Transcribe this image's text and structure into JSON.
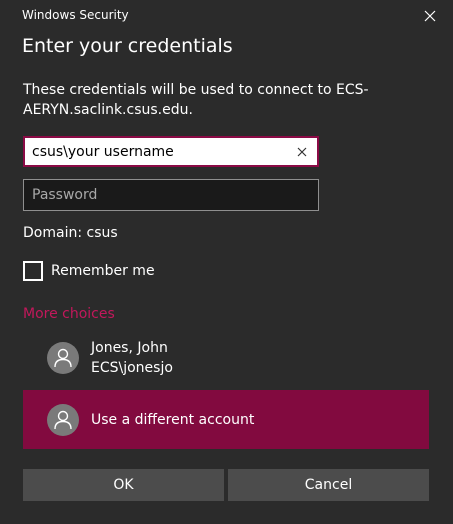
{
  "window": {
    "title": "Windows Security",
    "close_icon": "close-icon"
  },
  "heading": "Enter your credentials",
  "message": "These credentials will be used to connect to ECS-AERYN.saclink.csus.edu.",
  "username": {
    "value": "csus\\your username",
    "clear_icon": "clear-icon"
  },
  "password": {
    "value": "",
    "placeholder": "Password"
  },
  "domain": "Domain: csus",
  "remember": {
    "label": "Remember me",
    "checked": false
  },
  "more_choices": {
    "label": "More choices",
    "color": "#c2185b"
  },
  "accounts": [
    {
      "name": "Jones, John",
      "username": "ECS\\jonesjo",
      "icon": "user-avatar-icon"
    },
    {
      "label": "Use a different account",
      "icon": "user-avatar-icon",
      "highlight_color": "#820a3f"
    }
  ],
  "buttons": {
    "ok": "OK",
    "cancel": "Cancel"
  }
}
